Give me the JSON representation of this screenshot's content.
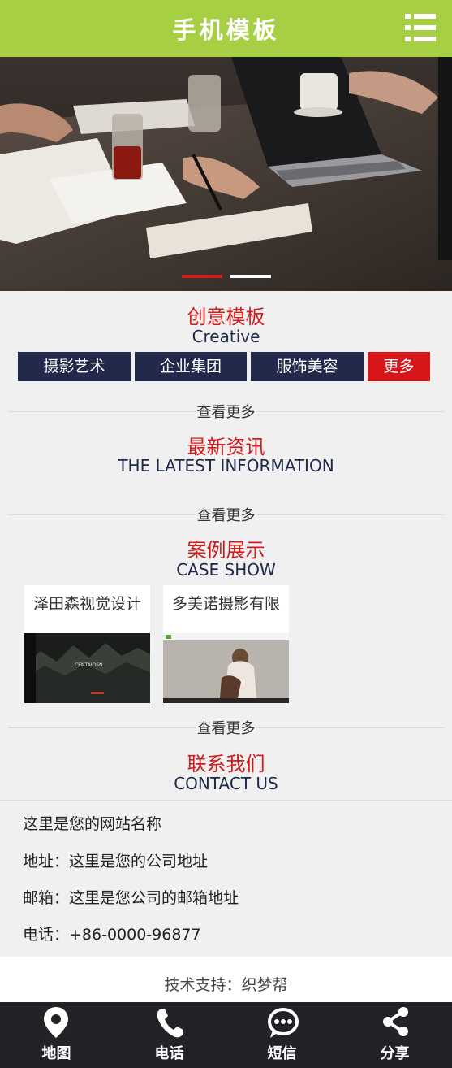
{
  "header": {
    "title": "手机模板",
    "menu_icon": "menu-icon"
  },
  "banner": {
    "active_slide": 1,
    "slide_count": 2
  },
  "creative": {
    "title_cn": "创意模板",
    "title_en": "Creative",
    "categories": [
      "摄影艺术",
      "企业集团",
      "服饰美容",
      "更多"
    ],
    "more_link": "查看更多"
  },
  "news": {
    "title_cn": "最新资讯",
    "title_en": "THE LATEST INFORMATION",
    "more_link": "查看更多"
  },
  "cases": {
    "title_cn": "案例展示",
    "title_en": "CASE SHOW",
    "items": [
      {
        "name": "泽田森视觉设计",
        "thumb_text": "CENTAIOSN"
      },
      {
        "name": "多美诺摄影有限",
        "thumb_text": ""
      }
    ],
    "more_link": "查看更多"
  },
  "contact": {
    "title_cn": "联系我们",
    "title_en": "CONTACT US",
    "site_name": "这里是您的网站名称",
    "address": "地址：这里是您的公司地址",
    "email": "邮箱：这里是您公司的邮箱地址",
    "phone": "电话：+86-0000-96877"
  },
  "support": {
    "text": "技术支持：织梦帮"
  },
  "footer": {
    "items": [
      {
        "label": "地图",
        "icon": "map-pin-icon"
      },
      {
        "label": "电话",
        "icon": "phone-icon"
      },
      {
        "label": "短信",
        "icon": "message-icon"
      },
      {
        "label": "分享",
        "icon": "share-icon"
      }
    ]
  },
  "colors": {
    "header_bg": "#a7cf44",
    "accent_red": "#d41a1a",
    "navy": "#22294a",
    "footer_bg": "#222327"
  }
}
